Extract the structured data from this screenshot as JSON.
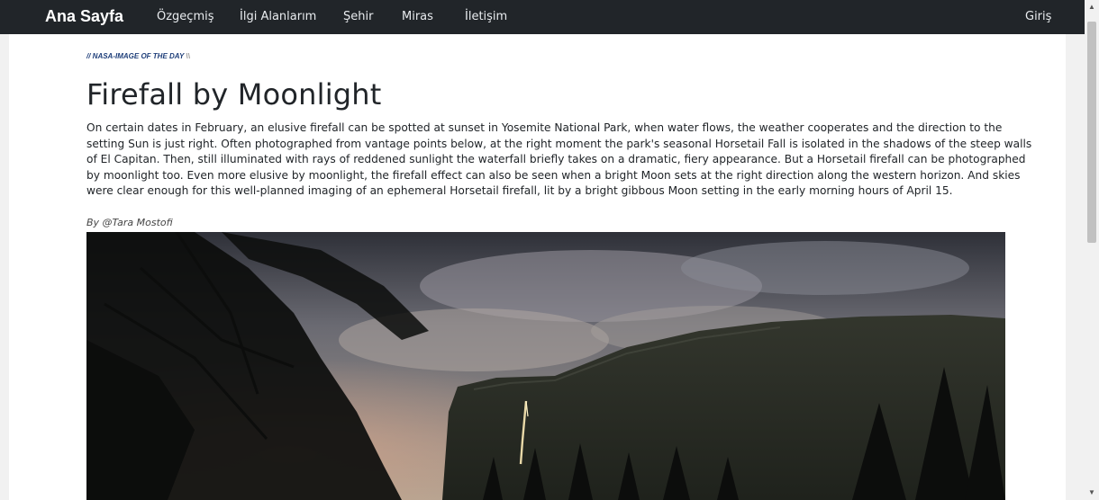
{
  "navbar": {
    "brand": "Ana Sayfa",
    "links": [
      "Özgeçmiş",
      "İlgi Alanlarım",
      "Şehir",
      "Miras",
      "İletişim"
    ],
    "login": "Giriş"
  },
  "article": {
    "kicker_main": "// NASA-IMAGE OF THE DAY",
    "kicker_tail": " \\\\",
    "title": "Firefall by Moonlight",
    "body": "On certain dates in February, an elusive firefall can be spotted at sunset in Yosemite National Park, when water flows, the weather cooperates and the direction to the setting Sun is just right. Often photographed from vantage points below, at the right moment the park's seasonal Horsetail Fall is isolated in the shadows of the steep walls of El Capitan. Then, still illuminated with rays of reddened sunlight the waterfall briefly takes on a dramatic, fiery appearance. But a Horsetail firefall can be photographed by moonlight too. Even more elusive by moonlight, the firefall effect can also be seen when a bright Moon sets at the right direction along the western horizon. And skies were clear enough for this well-planned imaging of an ephemeral Horsetail firefall, lit by a bright gibbous Moon setting in the early morning hours of April 15.",
    "credit": "By @Tara Mostofi"
  },
  "icons": {
    "scroll_up": "triangle-up-icon",
    "scroll_down": "triangle-down-icon"
  },
  "colors": {
    "navbar_bg": "#212529",
    "kicker": "#1f3f7a"
  }
}
